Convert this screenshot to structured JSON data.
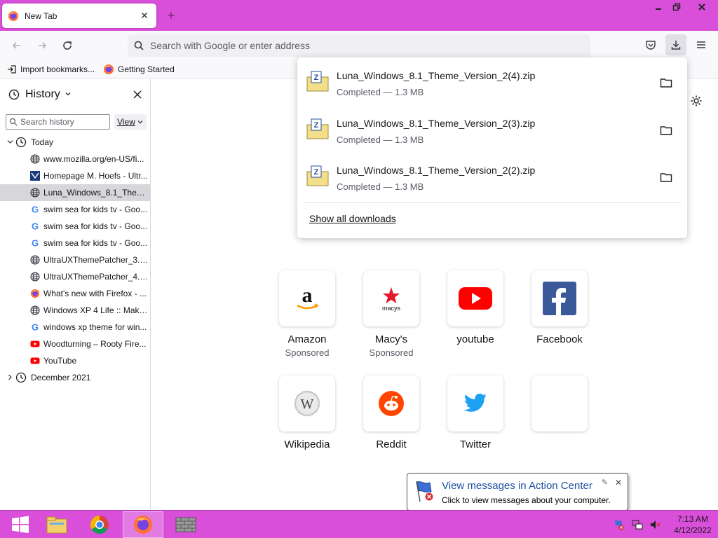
{
  "tab": {
    "title": "New Tab"
  },
  "urlbar": {
    "placeholder": "Search with Google or enter address"
  },
  "bookmarks": [
    {
      "label": "Import bookmarks...",
      "icon": "import-icon"
    },
    {
      "label": "Getting Started",
      "icon": "firefox-icon"
    }
  ],
  "sidebar": {
    "title": "History",
    "search_placeholder": "Search history",
    "view_label": "View",
    "groups": [
      {
        "label": "Today",
        "expanded": true
      },
      {
        "label": "December 2021",
        "expanded": false
      }
    ],
    "items": [
      {
        "label": "www.mozilla.org/en-US/fi...",
        "icon": "globe-icon"
      },
      {
        "label": "Homepage M. Hoefs - Ultr...",
        "icon": "site-icon"
      },
      {
        "label": "Luna_Windows_8.1_Them...",
        "icon": "globe-icon",
        "selected": true
      },
      {
        "label": "swim sea for kids tv - Goo...",
        "icon": "google-icon"
      },
      {
        "label": "swim sea for kids tv - Goo...",
        "icon": "google-icon"
      },
      {
        "label": "swim sea for kids tv - Goo...",
        "icon": "google-icon"
      },
      {
        "label": "UltraUXThemePatcher_3.0....",
        "icon": "globe-icon"
      },
      {
        "label": "UltraUXThemePatcher_4.3....",
        "icon": "globe-icon"
      },
      {
        "label": "What's new with Firefox - ...",
        "icon": "firefox-icon"
      },
      {
        "label": "Windows XP 4 Life :: Make ...",
        "icon": "globe-icon"
      },
      {
        "label": "windows xp theme for win...",
        "icon": "google-icon"
      },
      {
        "label": "Woodturning – Rooty Fire...",
        "icon": "youtube-icon"
      },
      {
        "label": "YouTube",
        "icon": "youtube-icon"
      }
    ]
  },
  "downloads": {
    "items": [
      {
        "name": "Luna_Windows_8.1_Theme_Version_2(4).zip",
        "status": "Completed — 1.3 MB"
      },
      {
        "name": "Luna_Windows_8.1_Theme_Version_2(3).zip",
        "status": "Completed — 1.3 MB"
      },
      {
        "name": "Luna_Windows_8.1_Theme_Version_2(2).zip",
        "status": "Completed — 1.3 MB"
      }
    ],
    "show_all": "Show all downloads"
  },
  "top_sites": [
    {
      "label": "Amazon",
      "sub": "Sponsored",
      "icon": "amazon-icon"
    },
    {
      "label": "Macy's",
      "sub": "Sponsored",
      "icon": "macys-icon"
    },
    {
      "label": "youtube",
      "sub": "",
      "icon": "youtube-icon"
    },
    {
      "label": "Facebook",
      "sub": "",
      "icon": "facebook-icon"
    },
    {
      "label": "Wikipedia",
      "sub": "",
      "icon": "wikipedia-icon"
    },
    {
      "label": "Reddit",
      "sub": "",
      "icon": "reddit-icon"
    },
    {
      "label": "Twitter",
      "sub": "",
      "icon": "twitter-icon"
    },
    {
      "label": "",
      "sub": "",
      "icon": "empty-tile"
    }
  ],
  "balloon": {
    "title": "View messages in Action Center",
    "text": "Click to view messages about your computer."
  },
  "taskbar": {
    "apps": [
      "start-button",
      "file-explorer-icon",
      "chrome-icon",
      "firefox-icon",
      "firewall-icon"
    ],
    "clock": {
      "time": "7:13 AM",
      "date": "4/12/2022"
    }
  },
  "colors": {
    "titlebar": "#d94fd9",
    "taskbar": "#d94fd9",
    "selection": "#d7d7db"
  }
}
